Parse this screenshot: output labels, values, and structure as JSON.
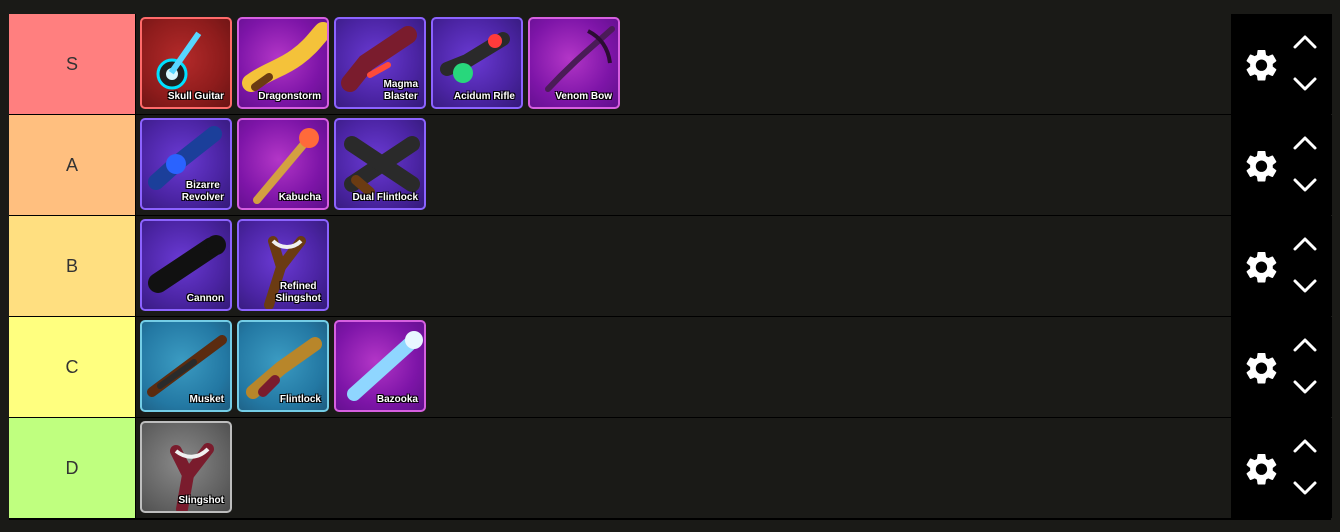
{
  "tiers": [
    {
      "label": "S",
      "color": "#ff7f7f",
      "items": [
        {
          "name": "Skull Guitar",
          "rarity": "red",
          "icon": "skull-guitar-icon"
        },
        {
          "name": "Dragonstorm",
          "rarity": "mythic",
          "icon": "dragonstorm-icon"
        },
        {
          "name": "Magma\nBlaster",
          "rarity": "legendary",
          "icon": "magma-blaster-icon"
        },
        {
          "name": "Acidum Rifle",
          "rarity": "legendary",
          "icon": "acidum-rifle-icon"
        },
        {
          "name": "Venom Bow",
          "rarity": "mythic",
          "icon": "venom-bow-icon"
        }
      ]
    },
    {
      "label": "A",
      "color": "#ffbf7f",
      "items": [
        {
          "name": "Bizarre\nRevolver",
          "rarity": "legendary",
          "icon": "bizarre-revolver-icon"
        },
        {
          "name": "Kabucha",
          "rarity": "mythic",
          "icon": "kabucha-icon"
        },
        {
          "name": "Dual Flintlock",
          "rarity": "legendary",
          "icon": "dual-flintlock-icon"
        }
      ]
    },
    {
      "label": "B",
      "color": "#ffdf80",
      "items": [
        {
          "name": "Cannon",
          "rarity": "legendary",
          "icon": "cannon-icon"
        },
        {
          "name": "Refined\nSlingshot",
          "rarity": "legendary",
          "icon": "refined-slingshot-icon"
        }
      ]
    },
    {
      "label": "C",
      "color": "#ffff7f",
      "items": [
        {
          "name": "Musket",
          "rarity": "rare",
          "icon": "musket-icon"
        },
        {
          "name": "Flintlock",
          "rarity": "rare",
          "icon": "flintlock-icon"
        },
        {
          "name": "Bazooka",
          "rarity": "mythic",
          "icon": "bazooka-icon"
        }
      ]
    },
    {
      "label": "D",
      "color": "#bfff7f",
      "items": [
        {
          "name": "Slingshot",
          "rarity": "common",
          "icon": "slingshot-icon"
        }
      ]
    }
  ],
  "controls": {
    "settings_icon": "gear-icon",
    "move_up_icon": "chevron-up-icon",
    "move_down_icon": "chevron-down-icon"
  }
}
